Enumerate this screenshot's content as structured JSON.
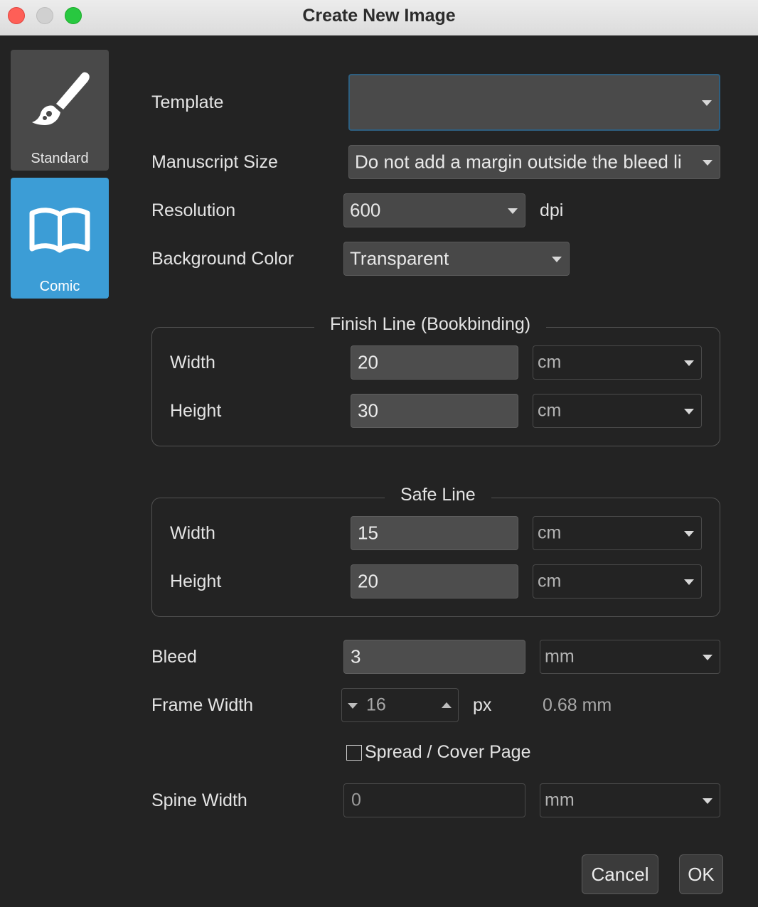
{
  "window": {
    "title": "Create New Image"
  },
  "sidebar": {
    "items": [
      {
        "label": "Standard",
        "icon": "paintbrush-icon",
        "selected": false
      },
      {
        "label": "Comic",
        "icon": "open-book-icon",
        "selected": true
      }
    ],
    "accent_color": "#3c9dd6"
  },
  "form": {
    "template": {
      "label": "Template",
      "value": ""
    },
    "manuscript_size": {
      "label": "Manuscript Size",
      "value": "Do not add a margin outside the bleed li"
    },
    "resolution": {
      "label": "Resolution",
      "value": "600",
      "unit": "dpi"
    },
    "background_color": {
      "label": "Background Color",
      "value": "Transparent"
    },
    "finish_line": {
      "title": "Finish Line (Bookbinding)",
      "width": {
        "label": "Width",
        "value": "20",
        "unit": "cm"
      },
      "height": {
        "label": "Height",
        "value": "30",
        "unit": "cm"
      }
    },
    "safe_line": {
      "title": "Safe Line",
      "width": {
        "label": "Width",
        "value": "15",
        "unit": "cm"
      },
      "height": {
        "label": "Height",
        "value": "20",
        "unit": "cm"
      }
    },
    "bleed": {
      "label": "Bleed",
      "value": "3",
      "unit": "mm"
    },
    "frame_width": {
      "label": "Frame Width",
      "value": "16",
      "unit": "px",
      "converted": "0.68 mm"
    },
    "spread": {
      "label": "Spread / Cover Page",
      "checked": false
    },
    "spine_width": {
      "label": "Spine Width",
      "value": "0",
      "unit": "mm"
    }
  },
  "buttons": {
    "cancel": "Cancel",
    "ok": "OK"
  }
}
